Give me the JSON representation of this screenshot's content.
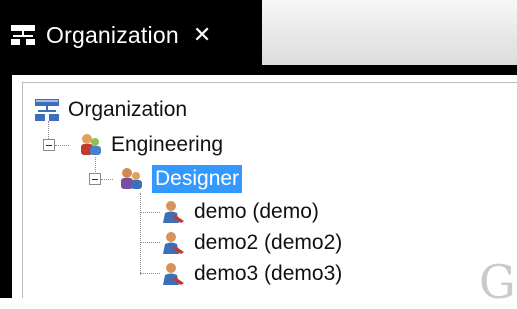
{
  "tab": {
    "title": "Organization",
    "close_glyph": "✕",
    "icon": "organization-icon"
  },
  "tree": {
    "root": {
      "label": "Organization",
      "icon": "organization-icon"
    },
    "group": {
      "label": "Engineering",
      "icon": "group-icon",
      "expanded": true
    },
    "role": {
      "label": "Designer",
      "icon": "role-icon",
      "expanded": true,
      "selected": true
    },
    "users": [
      {
        "label": "demo (demo)",
        "icon": "user-icon"
      },
      {
        "label": "demo2 (demo2)",
        "icon": "user-icon"
      },
      {
        "label": "demo3 (demo3)",
        "icon": "user-icon"
      }
    ]
  },
  "colors": {
    "selection": "#3399ff",
    "tab_background": "#000000",
    "tab_text": "#ffffff"
  },
  "watermark": {
    "text": "G"
  }
}
